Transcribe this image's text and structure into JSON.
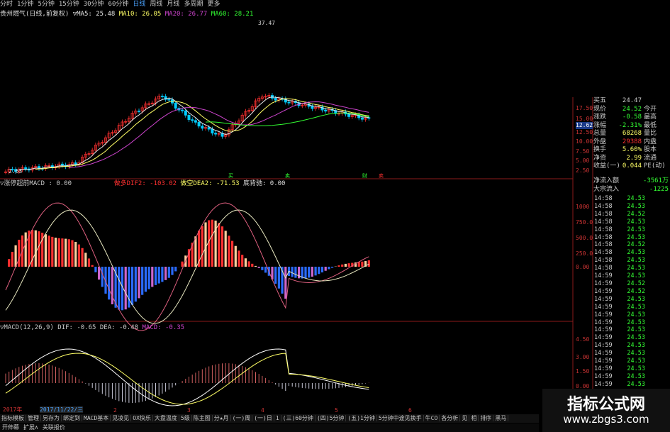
{
  "colors": {
    "up": "#ff3030",
    "down": "#2a6bff",
    "cyan": "#00ccff",
    "yellow": "#ffff66",
    "green": "#33ff33",
    "magenta": "#cc44cc",
    "white": "#e8e8e8",
    "red_axis": "#c33333"
  },
  "top_tabs": [
    "分时",
    "1分钟",
    "5分钟",
    "15分钟",
    "30分钟",
    "60分钟",
    "日线",
    "周线",
    "月线",
    "多周期",
    "更多"
  ],
  "active_tab": "日线",
  "stock_title": "贵州燃气(日线,前复权)",
  "ma_labels": {
    "ma5": "▽MA5: 25.48",
    "ma10": "MA10: 26.05",
    "ma20": "MA20: 26.77",
    "ma60": "MA60: 28.21"
  },
  "price_marks": {
    "high": "37.47",
    "low": "2.63"
  },
  "price_axis": [
    "17.50",
    "15.00",
    "12.62",
    "12.50",
    "10.00",
    "7.50",
    "5.00",
    "2.50"
  ],
  "signal_labels": [
    "买",
    "卖",
    "财",
    "卖"
  ],
  "macd2_title": {
    "name": "▽涨停超前MACD : 0.00",
    "dif": "做多DIF2: -103.02",
    "dea": "做空DEA2: -71.53",
    "bottom": "底背驰: 0.00"
  },
  "macd2_axis": [
    "1000",
    "750.0",
    "500.0",
    "250.0",
    "0.00"
  ],
  "macd_title": {
    "name": "▽MACD(12,26,9) DIF: -0.65 DEA: -0.48",
    "macd": "MACD: -0.35"
  },
  "macd_axis": [
    "4.50",
    "3.00",
    "1.50",
    "0.00"
  ],
  "quote": {
    "rows": [
      {
        "l": "买五",
        "v": "24.47",
        "vc": "#ccc",
        "l2": "",
        "v2": ""
      },
      {
        "l": "现价",
        "v": "24.52",
        "vc": "#33ff33",
        "l2": "今开",
        "v2": ""
      },
      {
        "l": "涨跌",
        "v": "-0.58",
        "vc": "#33ff33",
        "l2": "最高",
        "v2": ""
      },
      {
        "l": "涨幅",
        "v": "-2.31%",
        "vc": "#33ff33",
        "l2": "最低",
        "v2": ""
      },
      {
        "l": "总量",
        "v": "68268",
        "vc": "#ffff66",
        "l2": "量比",
        "v2": ""
      },
      {
        "l": "外盘",
        "v": "29388",
        "vc": "#ff3030",
        "l2": "内盘",
        "v2": ""
      },
      {
        "l": "换手",
        "v": "5.60%",
        "vc": "#ffff66",
        "l2": "股本",
        "v2": ""
      },
      {
        "l": "净资",
        "v": "2.99",
        "vc": "#ffff66",
        "l2": "流通",
        "v2": ""
      },
      {
        "l": "收益(一)",
        "v": "0.044",
        "vc": "#ffff66",
        "l2": "PE(动)",
        "v2": ""
      }
    ]
  },
  "flow": {
    "net_label": "净流入额",
    "net_value": "-3561万",
    "big_label": "大宗流入",
    "big_value": "-1225"
  },
  "ticks": [
    {
      "t": "14:58",
      "p": "24.53"
    },
    {
      "t": "14:58",
      "p": "24.53"
    },
    {
      "t": "14:58",
      "p": "24.52"
    },
    {
      "t": "14:58",
      "p": "24.53"
    },
    {
      "t": "14:58",
      "p": "24.53"
    },
    {
      "t": "14:58",
      "p": "24.53"
    },
    {
      "t": "14:58",
      "p": "24.52"
    },
    {
      "t": "14:58",
      "p": "24.53"
    },
    {
      "t": "14:58",
      "p": "24.53"
    },
    {
      "t": "14:58",
      "p": "24.53"
    },
    {
      "t": "14:59",
      "p": "24.53"
    },
    {
      "t": "14:59",
      "p": "24.52"
    },
    {
      "t": "14:59",
      "p": "24.52"
    },
    {
      "t": "14:59",
      "p": "24.53"
    },
    {
      "t": "14:59",
      "p": "24.53"
    },
    {
      "t": "14:59",
      "p": "24.53"
    },
    {
      "t": "14:59",
      "p": "24.53"
    },
    {
      "t": "14:59",
      "p": "24.53"
    },
    {
      "t": "14:59",
      "p": "24.53"
    },
    {
      "t": "14:59",
      "p": "24.53"
    },
    {
      "t": "14:59",
      "p": "24.53"
    },
    {
      "t": "14:59",
      "p": "24.53"
    },
    {
      "t": "14:59",
      "p": "24.53"
    },
    {
      "t": "14:59",
      "p": "24.53"
    },
    {
      "t": "14:59",
      "p": "24.53"
    },
    {
      "t": "14:59",
      "p": "24.52"
    },
    {
      "t": "14:59",
      "p": "24.52"
    },
    {
      "t": "14:59",
      "p": "24.53"
    }
  ],
  "date_strip": {
    "year": "2017年",
    "date": "2017/11/22/三",
    "marks": [
      "2",
      "3",
      "4",
      "5",
      "6"
    ]
  },
  "bottom_tabs": [
    "指标模板",
    "管理",
    "另存为",
    "绑定到",
    "MACD基本",
    "见凌见",
    "OX快乐",
    "大盘温度",
    "5级",
    "陈主图",
    "分★月",
    "(一)周",
    "(一)日",
    "1",
    "(三)60分钟",
    "(四)5分钟",
    "(五)1分钟",
    "5分钟中途见换手",
    "牛CO",
    "各分析",
    "见",
    "相",
    "排序",
    "黑马"
  ],
  "bottom_tabs2": [
    "开伸幕",
    "扩展∧",
    "关联报价"
  ],
  "watermark": {
    "title": "指标公式网",
    "url": "www.zbgs3.com"
  }
}
